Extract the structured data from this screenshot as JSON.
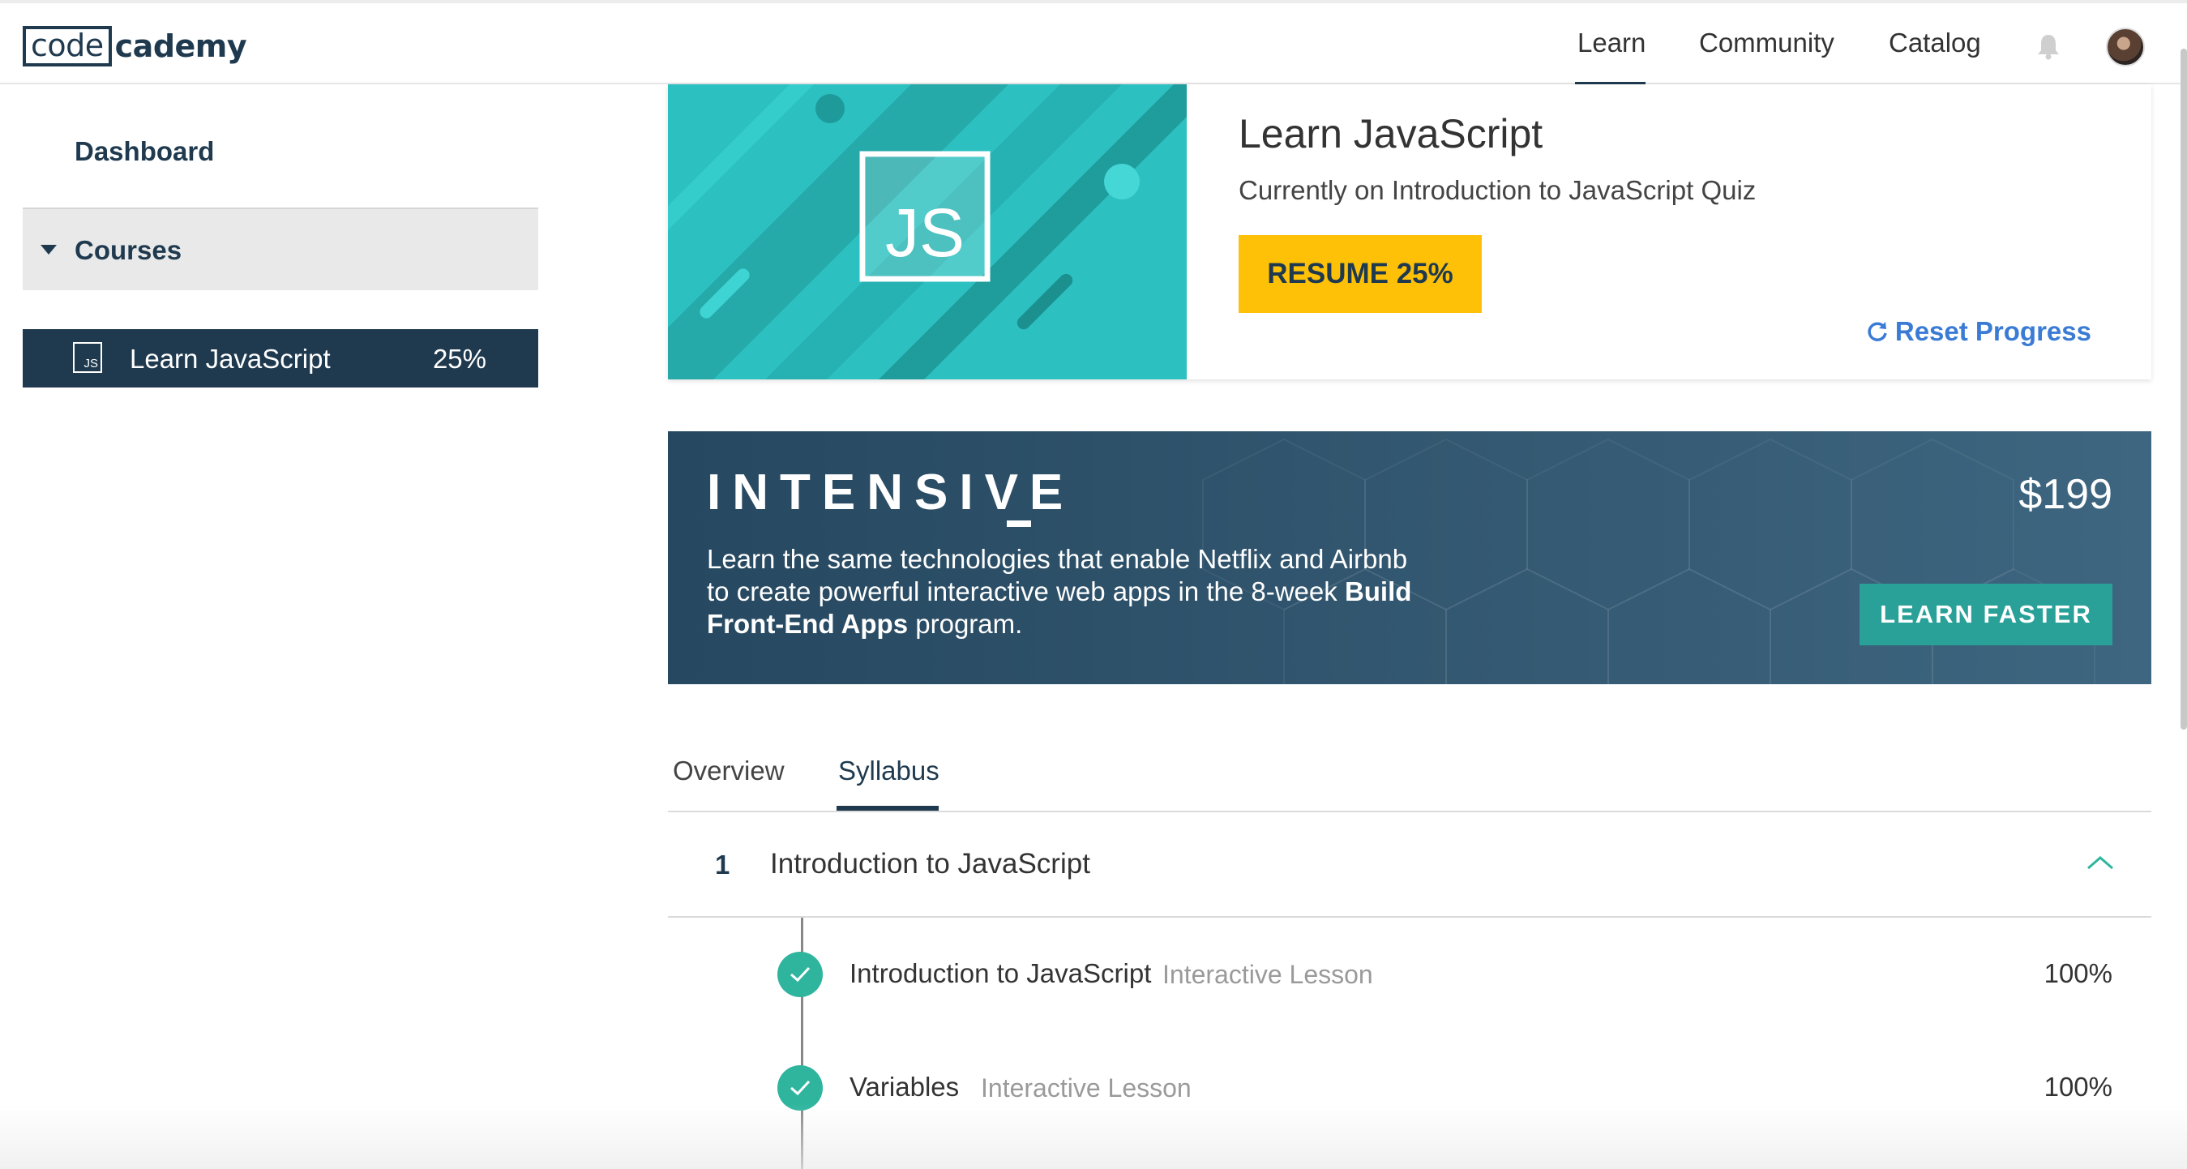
{
  "header": {
    "logo_boxed": "code",
    "logo_rest": "cademy",
    "nav": [
      "Learn",
      "Community",
      "Catalog"
    ],
    "active_nav": "Learn"
  },
  "sidebar": {
    "dashboard": "Dashboard",
    "courses": "Courses",
    "course": {
      "icon_text": "JS",
      "label": "Learn JavaScript",
      "progress": "25%"
    }
  },
  "course_card": {
    "badge": "JS",
    "title": "Learn JavaScript",
    "subtitle": "Currently on Introduction to JavaScript Quiz",
    "resume_label": "RESUME 25%",
    "reset_label": "Reset Progress",
    "accent_color": "#ffc107"
  },
  "banner": {
    "title": "INTENSIVE",
    "text_a": "Learn the same technologies that enable Netflix and Airbnb to create powerful interactive web apps in the 8-week ",
    "text_bold": "Build Front-End Apps",
    "text_b": " program.",
    "price": "$199",
    "cta": "LEARN FASTER",
    "cta_color": "#2aa198"
  },
  "tabs": [
    "Overview",
    "Syllabus"
  ],
  "active_tab": "Syllabus",
  "syllabus": {
    "chapter": {
      "number": "1",
      "title": "Introduction to JavaScript",
      "expanded": true
    },
    "lessons": [
      {
        "title": "Introduction to JavaScript",
        "type": "Interactive Lesson",
        "progress": "100%",
        "complete": true
      },
      {
        "title": "Variables",
        "type": "Interactive Lesson",
        "progress": "100%",
        "complete": true
      }
    ]
  }
}
